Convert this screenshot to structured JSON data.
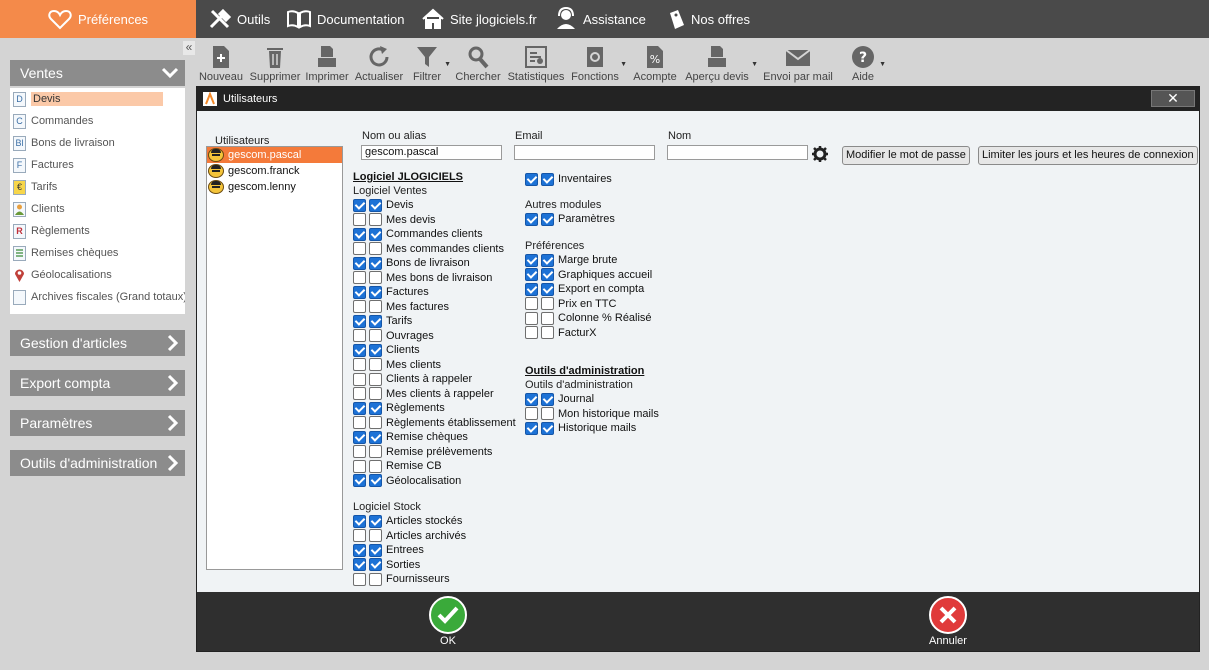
{
  "topnav": {
    "preferences": "Préférences",
    "items": [
      {
        "label": "Outils",
        "icon": "tools-icon"
      },
      {
        "label": "Documentation",
        "icon": "book-icon"
      },
      {
        "label": "Site jlogiciels.fr",
        "icon": "home-icon"
      },
      {
        "label": "Assistance",
        "icon": "headset-icon"
      },
      {
        "label": "Nos offres",
        "icon": "tag-icon"
      }
    ]
  },
  "sidebar": {
    "collapse": "«",
    "sections": [
      {
        "label": "Ventes",
        "expanded": true
      },
      {
        "label": "Gestion d'articles"
      },
      {
        "label": "Export compta"
      },
      {
        "label": "Paramètres"
      },
      {
        "label": "Outils d'administration"
      }
    ],
    "ventes_items": [
      {
        "label": "Devis",
        "icon": "D",
        "selected": true
      },
      {
        "label": "Commandes",
        "icon": "C"
      },
      {
        "label": "Bons de livraison",
        "icon": "Bl"
      },
      {
        "label": "Factures",
        "icon": "F"
      },
      {
        "label": "Tarifs",
        "icon": "€"
      },
      {
        "label": "Clients",
        "icon": "person"
      },
      {
        "label": "Règlements",
        "icon": "R"
      },
      {
        "label": "Remises chèques",
        "icon": "list"
      },
      {
        "label": "Géolocalisations",
        "icon": "pin"
      },
      {
        "label": "Archives fiscales (Grand totaux)",
        "icon": "doc"
      }
    ]
  },
  "toolbar": {
    "buttons": [
      {
        "label": "Nouveau"
      },
      {
        "label": "Supprimer"
      },
      {
        "label": "Imprimer"
      },
      {
        "label": "Actualiser"
      },
      {
        "label": "Filtrer"
      },
      {
        "label": "Chercher"
      },
      {
        "label": "Statistiques"
      },
      {
        "label": "Fonctions"
      },
      {
        "label": "Acompte"
      },
      {
        "label": "Aperçu devis"
      },
      {
        "label": "Envoi par mail"
      },
      {
        "label": "Aide"
      }
    ]
  },
  "dialog": {
    "title": "Utilisateurs",
    "close": "✕",
    "users_label": "Utilisateurs",
    "users": [
      {
        "name": "gescom.pascal",
        "selected": true
      },
      {
        "name": "gescom.franck"
      },
      {
        "name": "gescom.lenny"
      }
    ],
    "fields": {
      "name_label": "Nom ou alias",
      "name_value": "gescom.pascal",
      "email_label": "Email",
      "email_value": "",
      "nom_label": "Nom",
      "nom_value": ""
    },
    "buttons": {
      "password": "Modifier le mot de passe",
      "limit": "Limiter les jours et les heures de connexion"
    },
    "logiciel_title": "Logiciel JLOGICIELS",
    "ventes_title": "Logiciel Ventes",
    "ventes_perms": [
      {
        "label": "Devis",
        "a": true,
        "b": true
      },
      {
        "label": "Mes devis",
        "a": false,
        "b": false
      },
      {
        "label": "Commandes clients",
        "a": true,
        "b": true
      },
      {
        "label": "Mes commandes clients",
        "a": false,
        "b": false
      },
      {
        "label": "Bons de livraison",
        "a": true,
        "b": true
      },
      {
        "label": "Mes bons de livraison",
        "a": false,
        "b": false
      },
      {
        "label": "Factures",
        "a": true,
        "b": true
      },
      {
        "label": "Mes factures",
        "a": false,
        "b": false
      },
      {
        "label": "Tarifs",
        "a": true,
        "b": true
      },
      {
        "label": "Ouvrages",
        "a": false,
        "b": false
      },
      {
        "label": "Clients",
        "a": true,
        "b": true
      },
      {
        "label": "Mes clients",
        "a": false,
        "b": false
      },
      {
        "label": "Clients à rappeler",
        "a": false,
        "b": false
      },
      {
        "label": "Mes clients à rappeler",
        "a": false,
        "b": false
      },
      {
        "label": "Règlements",
        "a": true,
        "b": true
      },
      {
        "label": "Règlements établissement",
        "a": false,
        "b": false
      },
      {
        "label": "Remise chèques",
        "a": true,
        "b": true
      },
      {
        "label": "Remise prélèvements",
        "a": false,
        "b": false
      },
      {
        "label": "Remise CB",
        "a": false,
        "b": false
      },
      {
        "label": "Géolocalisation",
        "a": true,
        "b": true
      }
    ],
    "stock_title": "Logiciel Stock",
    "stock_perms": [
      {
        "label": "Articles stockés",
        "a": true,
        "b": true
      },
      {
        "label": "Articles archivés",
        "a": false,
        "b": false
      },
      {
        "label": "Entrees",
        "a": true,
        "b": true
      },
      {
        "label": "Sorties",
        "a": true,
        "b": true
      },
      {
        "label": "Fournisseurs",
        "a": false,
        "b": false
      }
    ],
    "inventaires": {
      "label": "Inventaires",
      "a": true,
      "b": true
    },
    "autres_title": "Autres modules",
    "autres_perms": [
      {
        "label": "Paramètres",
        "a": true,
        "b": true
      }
    ],
    "prefs_title": "Préférences",
    "prefs_perms": [
      {
        "label": "Marge brute",
        "a": true,
        "b": true
      },
      {
        "label": "Graphiques accueil",
        "a": true,
        "b": true
      },
      {
        "label": "Export en compta",
        "a": true,
        "b": true
      },
      {
        "label": "Prix en TTC",
        "a": false,
        "b": false
      },
      {
        "label": "Colonne % Réalisé",
        "a": false,
        "b": false
      },
      {
        "label": "FacturX",
        "a": false,
        "b": false
      }
    ],
    "admin_group_title": "Outils d'administration",
    "admin_title": "Outils d'administration",
    "admin_perms": [
      {
        "label": "Journal",
        "a": true,
        "b": true
      },
      {
        "label": "Mon historique mails",
        "a": false,
        "b": false
      },
      {
        "label": "Historique mails",
        "a": true,
        "b": true
      }
    ],
    "ok": "OK",
    "cancel": "Annuler",
    "colors": {
      "ok": "#3aaa3a",
      "cancel": "#e03a3a",
      "accent": "#f47a3a"
    }
  }
}
